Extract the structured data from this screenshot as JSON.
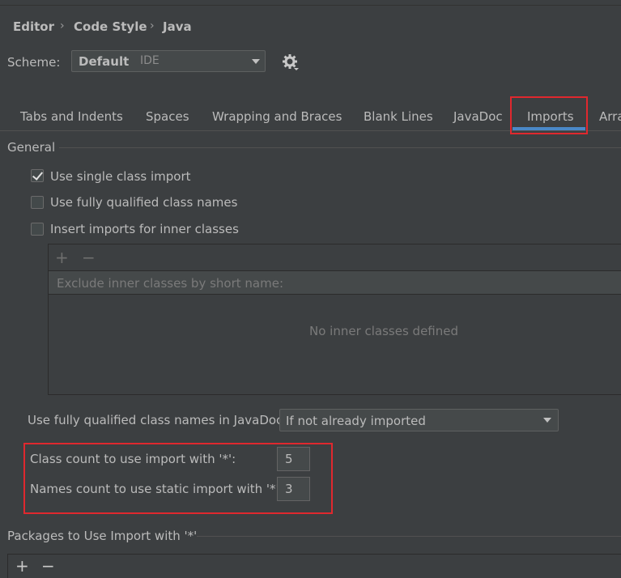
{
  "breadcrumb": [
    "Editor",
    "Code Style",
    "Java"
  ],
  "scheme": {
    "label": "Scheme:",
    "name": "Default",
    "suffix": "IDE"
  },
  "tabs": [
    "Tabs and Indents",
    "Spaces",
    "Wrapping and Braces",
    "Blank Lines",
    "JavaDoc",
    "Imports",
    "Arra"
  ],
  "active_tab": "Imports",
  "general": {
    "title": "General",
    "options": [
      {
        "label": "Use single class import",
        "checked": true
      },
      {
        "label": "Use fully qualified class names",
        "checked": false
      },
      {
        "label": "Insert imports for inner classes",
        "checked": false
      }
    ]
  },
  "inner_classes": {
    "toolbar": {
      "add": "+",
      "remove": "−"
    },
    "header": "Exclude inner classes by short name:",
    "empty_text": "No inner classes defined"
  },
  "javadoc": {
    "label": "Use fully qualified class names in JavaDoc:",
    "value": "If not already imported"
  },
  "class_count": {
    "label": "Class count to use import with '*':",
    "value": "5"
  },
  "names_count": {
    "label": "Names count to use static import with '*':",
    "value": "3"
  },
  "packages": {
    "title": "Packages to Use Import with '*'",
    "toolbar": {
      "add": "+",
      "remove": "−"
    }
  },
  "colors": {
    "background": "#3c3f41",
    "highlight": "#e0282e",
    "tab_underline": "#4a88c7"
  },
  "icons": [
    "gear-icon",
    "chevron-right-icon",
    "chevron-down-icon",
    "check-icon",
    "add-icon",
    "remove-icon"
  ]
}
